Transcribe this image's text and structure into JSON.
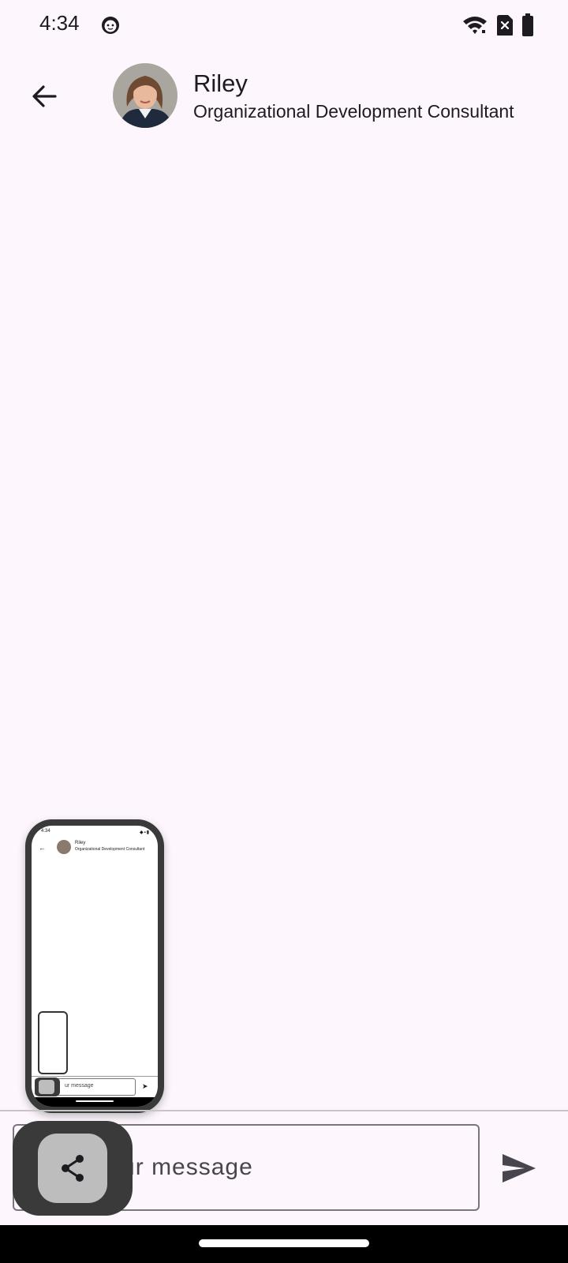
{
  "status_bar": {
    "time": "4:34",
    "app_icon": "android-debug-icon",
    "wifi_icon": "wifi-icon",
    "sim_icon": "no-sim-icon",
    "battery_icon": "battery-full-icon"
  },
  "header": {
    "back_icon": "arrow-back-icon",
    "contact_name": "Riley",
    "contact_role": "Organizational Development Consultant"
  },
  "thumbnail": {
    "time": "4:34",
    "contact_name": "Riley",
    "contact_role": "Organizational Development Consultant",
    "input_text": "ur message"
  },
  "composer": {
    "placeholder": "Type your message",
    "send_icon": "send-icon"
  },
  "share_button": {
    "icon": "share-icon"
  },
  "colors": {
    "background": "#FDF7FD",
    "fab_outer": "#3A3A3A",
    "fab_inner": "#BDBDBD",
    "outline": "#79747E"
  }
}
